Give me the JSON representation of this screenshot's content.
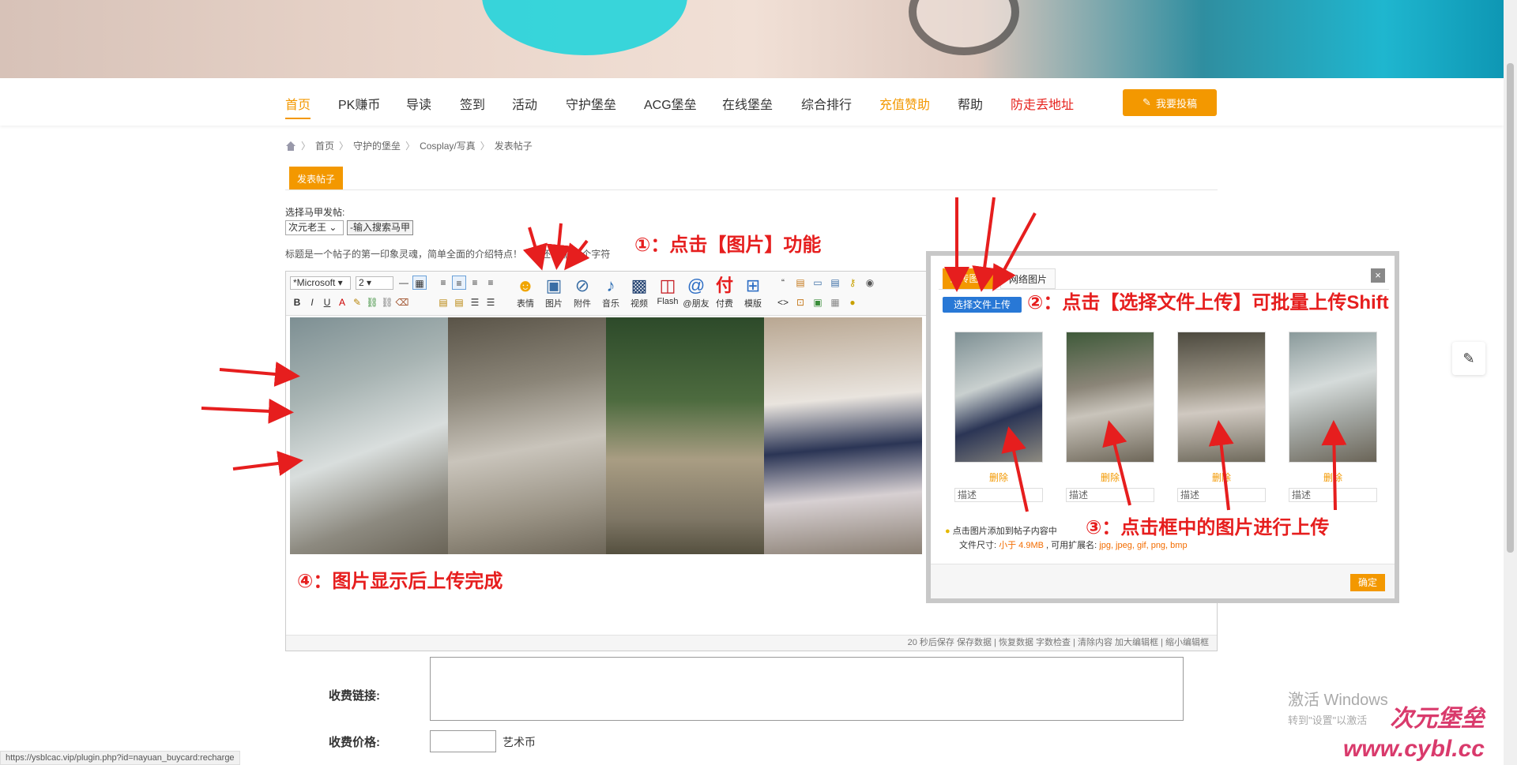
{
  "nav": {
    "items": [
      "首页",
      "PK赚币",
      "导读",
      "签到",
      "活动",
      "守护堡垒",
      "ACG堡垒",
      "在线堡垒",
      "综合排行",
      "充值赞助",
      "帮助",
      "防走丢地址"
    ],
    "post_button": "我要投稿"
  },
  "breadcrumb": [
    "首页",
    "守护的堡垒",
    "Cosplay/写真",
    "发表帖子"
  ],
  "tab_post": "发表帖子",
  "majia": {
    "label": "选择马甲发帖:",
    "selected": "次元老王",
    "search": "-输入搜索马甲"
  },
  "title_field": {
    "hint": "标题是一个帖子的第一印象灵魂，简单全面的介绍特点！",
    "counter": "还可输入 个字符"
  },
  "toolbar": {
    "font": "*Microsoft",
    "size": "2",
    "big_buttons": [
      "表情",
      "图片",
      "附件",
      "音乐",
      "视频",
      "Flash",
      "@朋友",
      "付费",
      "模版"
    ]
  },
  "editor_status": "20 秒后保存 保存数据 | 恢复数据   字数检查 | 清除内容   加大编辑框 | 缩小编辑框",
  "fee": {
    "link_label": "收费链接:",
    "price_label": "收费价格:",
    "unit": "艺术币"
  },
  "status_url": "https://ysblcac.vip/plugin.php?id=nayuan_buycard:recharge",
  "dialog": {
    "tab_local": "上传图片",
    "tab_net": "网络图片",
    "close": "×",
    "upload_button": "选择文件上传",
    "delete_label": "删除",
    "desc_placeholder": "描述",
    "tip_line1": "点击图片添加到帖子内容中",
    "tip_prefix": "文件尺寸: ",
    "tip_size": "小于 4.9MB",
    "tip_mid": " , 可用扩展名: ",
    "tip_ext": "jpg, jpeg, gif, png, bmp",
    "ok": "确定"
  },
  "annotations": {
    "step1": "①：点击【图片】功能",
    "step2": "②：点击【选择文件上传】可批量上传Shift",
    "step3": "③：点击框中的图片进行上传",
    "step4": "④：图片显示后上传完成"
  },
  "watermark": {
    "line1": "激活 Windows",
    "line2": "转到\"设置\"以激活"
  },
  "logo": {
    "name": "次元堡垒",
    "url": "www.cybl.cc"
  },
  "colors": {
    "accent": "#f39800",
    "annotation": "#e61e1e",
    "upload_blue": "#2878d6"
  }
}
